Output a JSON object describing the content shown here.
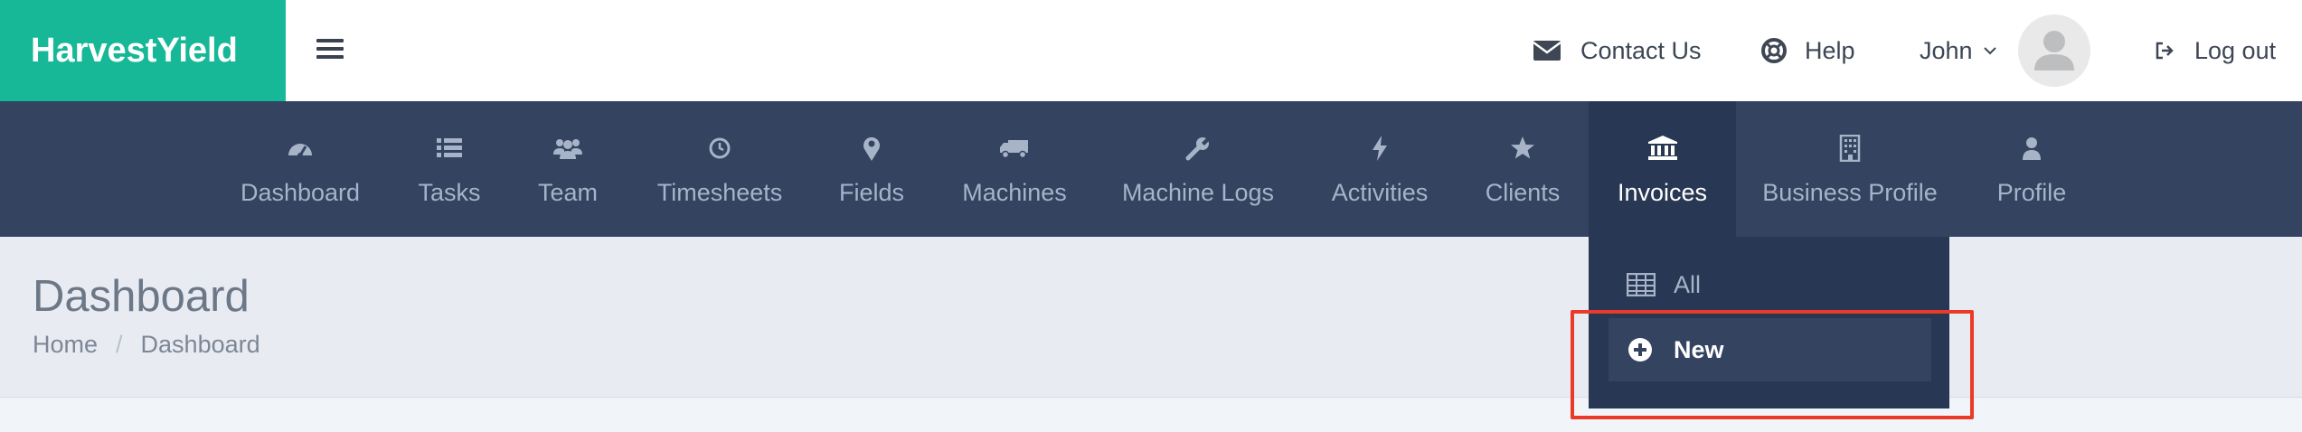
{
  "brand": {
    "name": "HarvestYield",
    "color": "#17b897"
  },
  "topbar": {
    "menu_icon": "hamburger-icon",
    "contact": {
      "label": "Contact Us",
      "icon": "envelope-icon"
    },
    "help": {
      "label": "Help",
      "icon": "life-ring-icon"
    },
    "user": {
      "name": "John",
      "icon": "chevron-down-icon"
    },
    "avatar": {
      "icon": "user-avatar-icon"
    },
    "logout": {
      "label": "Log out",
      "icon": "sign-out-icon"
    }
  },
  "nav": {
    "background": "#334360",
    "active_background": "#283753",
    "items": [
      {
        "label": "Dashboard",
        "icon": "dashboard-gauge-icon"
      },
      {
        "label": "Tasks",
        "icon": "list-icon"
      },
      {
        "label": "Team",
        "icon": "users-icon"
      },
      {
        "label": "Timesheets",
        "icon": "clock-icon"
      },
      {
        "label": "Fields",
        "icon": "map-marker-icon"
      },
      {
        "label": "Machines",
        "icon": "truck-icon"
      },
      {
        "label": "Machine Logs",
        "icon": "wrench-icon"
      },
      {
        "label": "Activities",
        "icon": "bolt-icon"
      },
      {
        "label": "Clients",
        "icon": "star-icon"
      },
      {
        "label": "Invoices",
        "icon": "bank-icon",
        "active": true
      },
      {
        "label": "Business Profile",
        "icon": "building-icon"
      },
      {
        "label": "Profile",
        "icon": "user-icon"
      }
    ]
  },
  "invoices_menu": {
    "items": [
      {
        "label": "All",
        "icon": "table-icon"
      },
      {
        "label": "New",
        "icon": "plus-circle-icon",
        "highlighted": true
      }
    ],
    "highlight_color": "#ea3a28"
  },
  "page": {
    "title": "Dashboard",
    "breadcrumb": [
      "Home",
      "Dashboard"
    ],
    "breadcrumb_separator": "/"
  }
}
